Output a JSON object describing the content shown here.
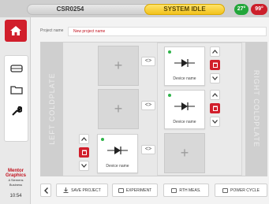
{
  "topbar": {
    "device": "CSR0254",
    "status": "SYSTEM IDLE",
    "temp_left": "27°",
    "temp_right": "99°"
  },
  "project": {
    "label": "Project name",
    "value": "New project name"
  },
  "coldplates": {
    "left": "LEFT COLDPLATE",
    "right": "RIGHT COLDPLATE"
  },
  "devices": [
    {
      "name": "Device name"
    },
    {
      "name": "Device name"
    },
    {
      "name": "Device name"
    }
  ],
  "swap_label": "<>",
  "slot_plus": "+",
  "toolbar": {
    "save": "SAVE PROJECT",
    "experiment": "EXPERIMENT",
    "rth": "RTH MEAS.",
    "power": "POWER CYCLE"
  },
  "logo": {
    "brand": "Mentor Graphics",
    "sub": "A Siemens Business"
  },
  "clock": "10:54",
  "colors": {
    "accent_red": "#d11e2b",
    "status_yellow": "#f2c21c",
    "temp_green": "#22a63a",
    "led_green": "#2fb34a",
    "frame_teal": "#1fb3b3"
  },
  "icons": [
    "home-icon",
    "drive-icon",
    "folder-icon",
    "wrench-icon",
    "diode-icon",
    "chevron-up-icon",
    "chevron-down-icon",
    "trash-icon",
    "back-icon",
    "download-icon",
    "chart-icon"
  ]
}
